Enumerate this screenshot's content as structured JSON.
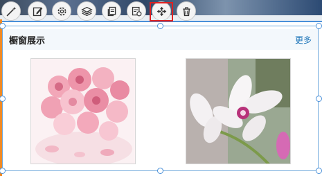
{
  "toolbar": {
    "items": [
      {
        "icon": "magic-wand-icon"
      },
      {
        "icon": "edit-icon"
      },
      {
        "icon": "gear-icon"
      },
      {
        "icon": "layers-icon"
      },
      {
        "icon": "copy-icon"
      },
      {
        "icon": "document-refresh-icon"
      },
      {
        "icon": "move-arrows-icon",
        "active": true
      },
      {
        "icon": "trash-icon"
      }
    ]
  },
  "module": {
    "title": "橱窗展示",
    "more": "更多"
  },
  "gallery": {
    "items": [
      {
        "subject": "pink-roses"
      },
      {
        "subject": "white-orchid"
      }
    ]
  },
  "colors": {
    "frame": "#4a90d9",
    "highlight": "#e02020",
    "edge": "#f08a24",
    "link": "#1a73b8"
  }
}
